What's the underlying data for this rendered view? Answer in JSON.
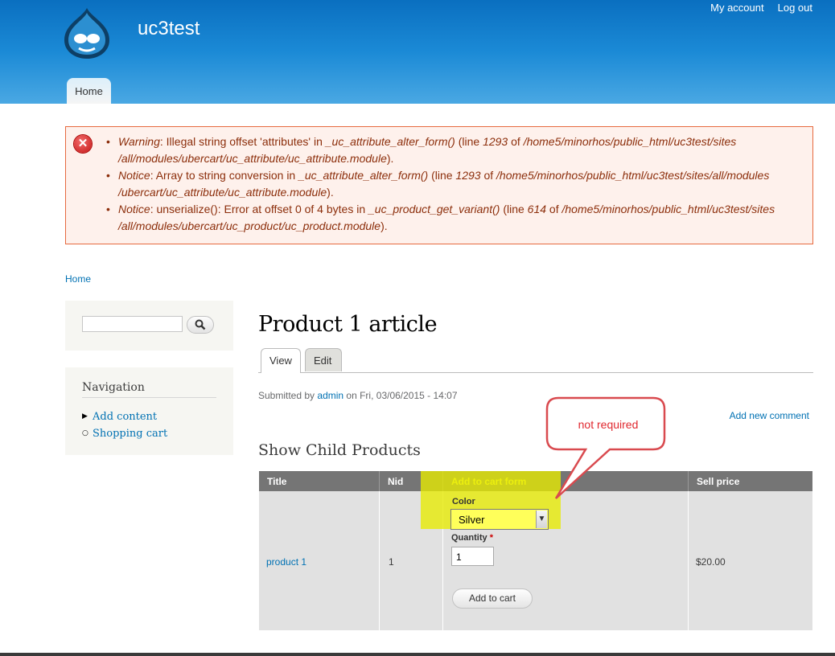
{
  "site": {
    "name": "uc3test"
  },
  "secondary_menu": [
    "My account",
    "Log out"
  ],
  "main_menu": {
    "home": "Home"
  },
  "messages": [
    [
      {
        "t": "Warning",
        "i": true
      },
      {
        "t": ": Illegal string offset 'attributes' in ",
        "i": false
      },
      {
        "t": "_uc_attribute_alter_form()",
        "i": true
      },
      {
        "t": " (line ",
        "i": false
      },
      {
        "t": "1293",
        "i": true
      },
      {
        "t": " of ",
        "i": false
      },
      {
        "t": "/home5/minorhos/public_html/uc3test/sites /all/modules/ubercart/uc_attribute/uc_attribute.module",
        "i": true
      },
      {
        "t": ").",
        "i": false
      }
    ],
    [
      {
        "t": "Notice",
        "i": true
      },
      {
        "t": ": Array to string conversion in ",
        "i": false
      },
      {
        "t": "_uc_attribute_alter_form()",
        "i": true
      },
      {
        "t": " (line ",
        "i": false
      },
      {
        "t": "1293",
        "i": true
      },
      {
        "t": " of ",
        "i": false
      },
      {
        "t": "/home5/minorhos/public_html/uc3test/sites/all/modules /ubercart/uc_attribute/uc_attribute.module",
        "i": true
      },
      {
        "t": ").",
        "i": false
      }
    ],
    [
      {
        "t": "Notice",
        "i": true
      },
      {
        "t": ": unserialize(): Error at offset 0 of 4 bytes in ",
        "i": false
      },
      {
        "t": "_uc_product_get_variant()",
        "i": true
      },
      {
        "t": " (line ",
        "i": false
      },
      {
        "t": "614",
        "i": true
      },
      {
        "t": " of ",
        "i": false
      },
      {
        "t": "/home5/minorhos/public_html/uc3test/sites /all/modules/ubercart/uc_product/uc_product.module",
        "i": true
      },
      {
        "t": ").",
        "i": false
      }
    ]
  ],
  "breadcrumb": "Home",
  "search": {
    "value": "",
    "button_icon": "search-icon"
  },
  "navigation": {
    "title": "Navigation",
    "items": [
      {
        "label": "Add content",
        "bullet": "▶"
      },
      {
        "label": "Shopping cart",
        "bullet": "○"
      }
    ]
  },
  "page": {
    "title": "Product 1 article",
    "tabs": [
      "View",
      "Edit"
    ],
    "submitted_prefix": "Submitted by",
    "author": "admin",
    "submitted_suffix": "on Fri, 03/06/2015 - 14:07",
    "add_comment": "Add new comment"
  },
  "child_products": {
    "title": "Show Child Products",
    "headers": [
      "Title",
      "Nid",
      "Add to cart form",
      "Sell price"
    ],
    "row": {
      "title": "product 1",
      "nid": "1",
      "color_label": "Color",
      "color_value": "Silver",
      "quantity_label": "Quantity",
      "required_mark": "*",
      "quantity_value": "1",
      "add_to_cart": "Add to cart",
      "price": "$20.00"
    }
  },
  "annotation": {
    "text": "not required"
  },
  "colors": {
    "header_top": "#0a6fc0",
    "link": "#0071b3",
    "error_text": "#8c2e0b",
    "highlight": "#e7ea00",
    "callout": "#e0282f"
  }
}
